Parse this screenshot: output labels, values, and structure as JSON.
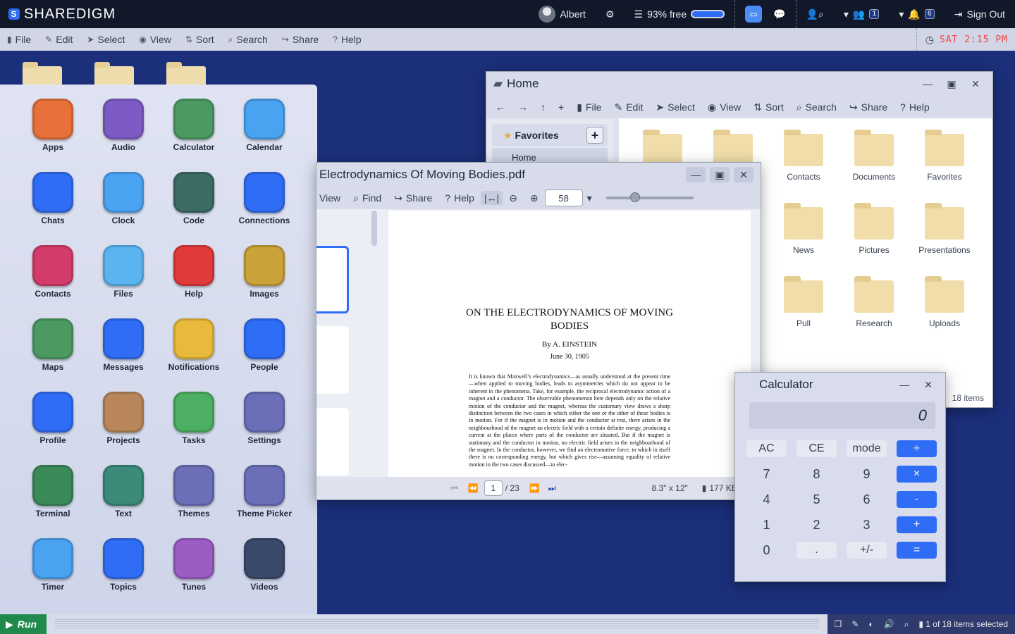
{
  "brand": {
    "name": "SHAREDIGM"
  },
  "topbar": {
    "user": "Albert",
    "storage": "93% free",
    "badge_one": "1",
    "badge_two": "6",
    "sign_out": "Sign Out"
  },
  "menu": {
    "items": [
      "File",
      "Edit",
      "Select",
      "View",
      "Sort",
      "Search",
      "Share",
      "Help"
    ],
    "clock": "SAT 2:15 PM"
  },
  "launcher": {
    "apps": [
      {
        "label": "Apps",
        "icon": "rocket-icon",
        "color": "#e8703a"
      },
      {
        "label": "Audio",
        "icon": "headphones-icon",
        "color": "#7c5cc4"
      },
      {
        "label": "Calculator",
        "icon": "calculator-icon",
        "color": "#4c9a62"
      },
      {
        "label": "Calendar",
        "icon": "calendar-icon",
        "color": "#4aa3f0"
      },
      {
        "label": "Chats",
        "icon": "messenger-icon",
        "color": "#2f6df6"
      },
      {
        "label": "Clock",
        "icon": "clock-icon",
        "color": "#4aa3f0"
      },
      {
        "label": "Code",
        "icon": "code-icon",
        "color": "#3b6b63"
      },
      {
        "label": "Connections",
        "icon": "people-icon",
        "color": "#2f6df6"
      },
      {
        "label": "Contacts",
        "icon": "address-book-icon",
        "color": "#d33c6a"
      },
      {
        "label": "Files",
        "icon": "folder-icon",
        "color": "#5bb4f0"
      },
      {
        "label": "Help",
        "icon": "question-icon",
        "color": "#e03a3a"
      },
      {
        "label": "Images",
        "icon": "camera-icon",
        "color": "#c9a23a"
      },
      {
        "label": "Maps",
        "icon": "map-icon",
        "color": "#4c9a62"
      },
      {
        "label": "Messages",
        "icon": "hashtag-bubble-icon",
        "color": "#2f6df6"
      },
      {
        "label": "Notifications",
        "icon": "warning-icon",
        "color": "#e8b93a"
      },
      {
        "label": "People",
        "icon": "magnifier-icon",
        "color": "#2f6df6"
      },
      {
        "label": "Profile",
        "icon": "person-icon",
        "color": "#2f6df6"
      },
      {
        "label": "Projects",
        "icon": "clipboard-icon",
        "color": "#b8865a"
      },
      {
        "label": "Tasks",
        "icon": "checkmark-icon",
        "color": "#4caf62"
      },
      {
        "label": "Settings",
        "icon": "gears-icon",
        "color": "#6b6fb8"
      },
      {
        "label": "Terminal",
        "icon": "terminal-icon",
        "color": "#3b8a5a"
      },
      {
        "label": "Text",
        "icon": "document-icon",
        "color": "#3b8a7a"
      },
      {
        "label": "Themes",
        "icon": "palette-icon",
        "color": "#6b6fb8"
      },
      {
        "label": "Theme Picker",
        "icon": "paint-roller-icon",
        "color": "#6b6fb8"
      },
      {
        "label": "Timer",
        "icon": "hourglass-icon",
        "color": "#4aa3f0"
      },
      {
        "label": "Topics",
        "icon": "hashtag-icon",
        "color": "#2f6df6"
      },
      {
        "label": "Tunes",
        "icon": "music-note-icon",
        "color": "#9c5cc4"
      },
      {
        "label": "Videos",
        "icon": "play-icon",
        "color": "#3b4a6b"
      }
    ]
  },
  "home": {
    "title": "Home",
    "toolbar": [
      "File",
      "Edit",
      "Select",
      "View",
      "Sort",
      "Search",
      "Share",
      "Help"
    ],
    "sidebar": {
      "favorites": "Favorites",
      "item": "Home"
    },
    "folders": [
      {
        "label": "",
        "icon": "speaker-icon"
      },
      {
        "label": "",
        "icon": "braces-icon"
      },
      {
        "label": "Contacts",
        "icon": "contact-card-icon"
      },
      {
        "label": "Documents",
        "icon": "document-icon"
      },
      {
        "label": "Favorites",
        "icon": "star-icon"
      },
      {
        "label": "News",
        "icon": "newspaper-icon"
      },
      {
        "label": "Pictures",
        "icon": "picture-icon"
      },
      {
        "label": "Presentations",
        "icon": "presentation-icon"
      },
      {
        "label": "Pull",
        "icon": "folder-icon"
      },
      {
        "label": "Research",
        "icon": "flask-icon"
      },
      {
        "label": "Uploads",
        "icon": "upload-arrow-icon"
      }
    ],
    "count": "18 items"
  },
  "pdf": {
    "title": "Electrodynamics Of Moving Bodies.pdf",
    "toolbar": {
      "view": "View",
      "find": "Find",
      "share": "Share",
      "help": "Help",
      "zoom": "58"
    },
    "page": {
      "title": "ON THE ELECTRODYNAMICS OF MOVING BODIES",
      "author": "By A. EINSTEIN",
      "date": "June 30, 1905",
      "abstract": "It is known that Maxwell’s electrodynamics—as usually understood at the present time—when applied to moving bodies, leads to asymmetries which do not appear to be inherent in the phenomena. Take, for example, the reciprocal electrodynamic action of a magnet and a conductor. The observable phenomenon here depends only on the relative motion of the conductor and the magnet, whereas the customary view draws a sharp distinction between the two cases in which either the one or the other of these bodies is in motion. For if the magnet is in motion and the conductor at rest, there arises in the neighbourhood of the magnet an electric field with a certain definite energy, producing a current at the places where parts of the conductor are situated. But if the magnet is stationary and the conductor in motion, no electric field arises in the neighbourhood of the magnet. In the conductor, however, we find an electromotive force, to which in itself there is no corresponding energy, but which gives rise—assuming equality of relative motion in the two cases discussed—to elec-"
    },
    "footer": {
      "current_page": "1",
      "total": "/ 23",
      "size": "8.3\" x 12\"",
      "filesize": "177 KB"
    }
  },
  "calc": {
    "title": "Calculator",
    "display": "0",
    "keys": [
      {
        "label": "AC",
        "kind": "fn"
      },
      {
        "label": "CE",
        "kind": "fn"
      },
      {
        "label": "mode",
        "kind": "fn"
      },
      {
        "label": "÷",
        "kind": "op"
      },
      {
        "label": "7",
        "kind": "num"
      },
      {
        "label": "8",
        "kind": "num"
      },
      {
        "label": "9",
        "kind": "num"
      },
      {
        "label": "×",
        "kind": "op"
      },
      {
        "label": "4",
        "kind": "num"
      },
      {
        "label": "5",
        "kind": "num"
      },
      {
        "label": "6",
        "kind": "num"
      },
      {
        "label": "-",
        "kind": "op"
      },
      {
        "label": "1",
        "kind": "num"
      },
      {
        "label": "2",
        "kind": "num"
      },
      {
        "label": "3",
        "kind": "num"
      },
      {
        "label": "+",
        "kind": "op"
      },
      {
        "label": "0",
        "kind": "num"
      },
      {
        "label": ".",
        "kind": "fn"
      },
      {
        "label": "+/-",
        "kind": "fn"
      },
      {
        "label": "=",
        "kind": "op"
      }
    ]
  },
  "taskbar": {
    "run": "Run",
    "selection": "1 of 18 items selected"
  }
}
